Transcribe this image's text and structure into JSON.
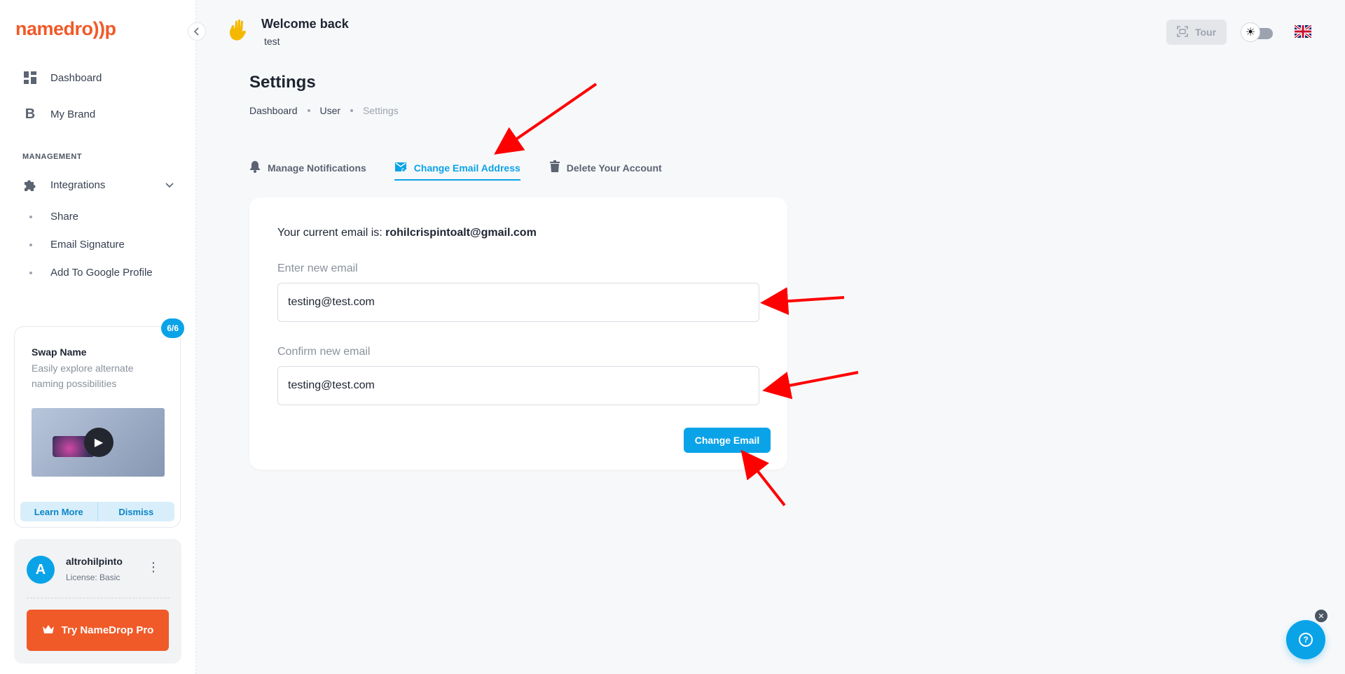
{
  "brand": {
    "logo_part1": "namedro",
    "logo_part2": "))p"
  },
  "sidebar": {
    "nav": [
      {
        "label": "Dashboard",
        "icon": "grid-icon"
      },
      {
        "label": "My Brand",
        "icon": "letter-b-icon"
      }
    ],
    "section_label": "MANAGEMENT",
    "integrations": {
      "label": "Integrations",
      "icon": "puzzle-icon"
    },
    "sub_items": [
      "Share",
      "Email Signature",
      "Add To Google Profile"
    ],
    "promo": {
      "badge": "6/6",
      "title": "Swap Name",
      "description": "Easily explore alternate naming possibilities",
      "learn_more": "Learn More",
      "dismiss": "Dismiss"
    },
    "user": {
      "initial": "A",
      "name": "altrohilpinto",
      "license": "License: Basic",
      "cta": "Try NameDrop Pro"
    }
  },
  "header": {
    "welcome": "Welcome back",
    "subtitle": "test",
    "tour_label": "Tour"
  },
  "page": {
    "title": "Settings",
    "breadcrumb": [
      "Dashboard",
      "User",
      "Settings"
    ]
  },
  "tabs": [
    {
      "label": "Manage Notifications",
      "icon": "bell-icon",
      "active": false
    },
    {
      "label": "Change Email Address",
      "icon": "mail-check-icon",
      "active": true
    },
    {
      "label": "Delete Your Account",
      "icon": "trash-icon",
      "active": false
    }
  ],
  "form": {
    "current_prefix": "Your current email is:",
    "current_email": "rohilcrispintoalt@gmail.com",
    "new_label": "Enter new email",
    "new_value": "testing@test.com",
    "confirm_label": "Confirm new email",
    "confirm_value": "testing@test.com",
    "submit": "Change Email"
  },
  "colors": {
    "accent": "#0aa3e8",
    "brand": "#f05a28",
    "annotation": "#ff0000"
  }
}
